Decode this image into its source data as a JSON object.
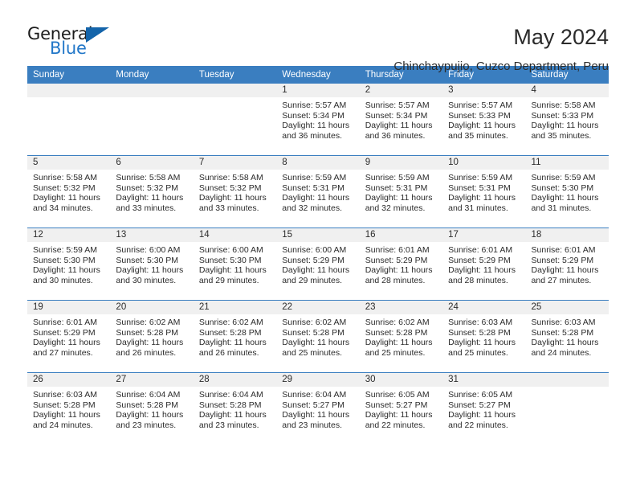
{
  "brand": {
    "name_top": "General",
    "name_bottom": "Blue",
    "accent_color": "#1464aa",
    "blue_text_color": "#2277c8"
  },
  "header": {
    "title": "May 2024",
    "location": "Chinchaypujio, Cuzco Department, Peru"
  },
  "calendar": {
    "header_color": "#3a7ec0",
    "daynum_band_color": "#f0f0f0",
    "weekdays": [
      "Sunday",
      "Monday",
      "Tuesday",
      "Wednesday",
      "Thursday",
      "Friday",
      "Saturday"
    ],
    "weeks": [
      [
        {
          "day": "",
          "sunrise": "",
          "sunset": "",
          "daylight": "",
          "empty": true
        },
        {
          "day": "",
          "sunrise": "",
          "sunset": "",
          "daylight": "",
          "empty": true
        },
        {
          "day": "",
          "sunrise": "",
          "sunset": "",
          "daylight": "",
          "empty": true
        },
        {
          "day": "1",
          "sunrise": "Sunrise: 5:57 AM",
          "sunset": "Sunset: 5:34 PM",
          "daylight": "Daylight: 11 hours and 36 minutes.",
          "empty": false
        },
        {
          "day": "2",
          "sunrise": "Sunrise: 5:57 AM",
          "sunset": "Sunset: 5:34 PM",
          "daylight": "Daylight: 11 hours and 36 minutes.",
          "empty": false
        },
        {
          "day": "3",
          "sunrise": "Sunrise: 5:57 AM",
          "sunset": "Sunset: 5:33 PM",
          "daylight": "Daylight: 11 hours and 35 minutes.",
          "empty": false
        },
        {
          "day": "4",
          "sunrise": "Sunrise: 5:58 AM",
          "sunset": "Sunset: 5:33 PM",
          "daylight": "Daylight: 11 hours and 35 minutes.",
          "empty": false
        }
      ],
      [
        {
          "day": "5",
          "sunrise": "Sunrise: 5:58 AM",
          "sunset": "Sunset: 5:32 PM",
          "daylight": "Daylight: 11 hours and 34 minutes.",
          "empty": false
        },
        {
          "day": "6",
          "sunrise": "Sunrise: 5:58 AM",
          "sunset": "Sunset: 5:32 PM",
          "daylight": "Daylight: 11 hours and 33 minutes.",
          "empty": false
        },
        {
          "day": "7",
          "sunrise": "Sunrise: 5:58 AM",
          "sunset": "Sunset: 5:32 PM",
          "daylight": "Daylight: 11 hours and 33 minutes.",
          "empty": false
        },
        {
          "day": "8",
          "sunrise": "Sunrise: 5:59 AM",
          "sunset": "Sunset: 5:31 PM",
          "daylight": "Daylight: 11 hours and 32 minutes.",
          "empty": false
        },
        {
          "day": "9",
          "sunrise": "Sunrise: 5:59 AM",
          "sunset": "Sunset: 5:31 PM",
          "daylight": "Daylight: 11 hours and 32 minutes.",
          "empty": false
        },
        {
          "day": "10",
          "sunrise": "Sunrise: 5:59 AM",
          "sunset": "Sunset: 5:31 PM",
          "daylight": "Daylight: 11 hours and 31 minutes.",
          "empty": false
        },
        {
          "day": "11",
          "sunrise": "Sunrise: 5:59 AM",
          "sunset": "Sunset: 5:30 PM",
          "daylight": "Daylight: 11 hours and 31 minutes.",
          "empty": false
        }
      ],
      [
        {
          "day": "12",
          "sunrise": "Sunrise: 5:59 AM",
          "sunset": "Sunset: 5:30 PM",
          "daylight": "Daylight: 11 hours and 30 minutes.",
          "empty": false
        },
        {
          "day": "13",
          "sunrise": "Sunrise: 6:00 AM",
          "sunset": "Sunset: 5:30 PM",
          "daylight": "Daylight: 11 hours and 30 minutes.",
          "empty": false
        },
        {
          "day": "14",
          "sunrise": "Sunrise: 6:00 AM",
          "sunset": "Sunset: 5:30 PM",
          "daylight": "Daylight: 11 hours and 29 minutes.",
          "empty": false
        },
        {
          "day": "15",
          "sunrise": "Sunrise: 6:00 AM",
          "sunset": "Sunset: 5:29 PM",
          "daylight": "Daylight: 11 hours and 29 minutes.",
          "empty": false
        },
        {
          "day": "16",
          "sunrise": "Sunrise: 6:01 AM",
          "sunset": "Sunset: 5:29 PM",
          "daylight": "Daylight: 11 hours and 28 minutes.",
          "empty": false
        },
        {
          "day": "17",
          "sunrise": "Sunrise: 6:01 AM",
          "sunset": "Sunset: 5:29 PM",
          "daylight": "Daylight: 11 hours and 28 minutes.",
          "empty": false
        },
        {
          "day": "18",
          "sunrise": "Sunrise: 6:01 AM",
          "sunset": "Sunset: 5:29 PM",
          "daylight": "Daylight: 11 hours and 27 minutes.",
          "empty": false
        }
      ],
      [
        {
          "day": "19",
          "sunrise": "Sunrise: 6:01 AM",
          "sunset": "Sunset: 5:29 PM",
          "daylight": "Daylight: 11 hours and 27 minutes.",
          "empty": false
        },
        {
          "day": "20",
          "sunrise": "Sunrise: 6:02 AM",
          "sunset": "Sunset: 5:28 PM",
          "daylight": "Daylight: 11 hours and 26 minutes.",
          "empty": false
        },
        {
          "day": "21",
          "sunrise": "Sunrise: 6:02 AM",
          "sunset": "Sunset: 5:28 PM",
          "daylight": "Daylight: 11 hours and 26 minutes.",
          "empty": false
        },
        {
          "day": "22",
          "sunrise": "Sunrise: 6:02 AM",
          "sunset": "Sunset: 5:28 PM",
          "daylight": "Daylight: 11 hours and 25 minutes.",
          "empty": false
        },
        {
          "day": "23",
          "sunrise": "Sunrise: 6:02 AM",
          "sunset": "Sunset: 5:28 PM",
          "daylight": "Daylight: 11 hours and 25 minutes.",
          "empty": false
        },
        {
          "day": "24",
          "sunrise": "Sunrise: 6:03 AM",
          "sunset": "Sunset: 5:28 PM",
          "daylight": "Daylight: 11 hours and 25 minutes.",
          "empty": false
        },
        {
          "day": "25",
          "sunrise": "Sunrise: 6:03 AM",
          "sunset": "Sunset: 5:28 PM",
          "daylight": "Daylight: 11 hours and 24 minutes.",
          "empty": false
        }
      ],
      [
        {
          "day": "26",
          "sunrise": "Sunrise: 6:03 AM",
          "sunset": "Sunset: 5:28 PM",
          "daylight": "Daylight: 11 hours and 24 minutes.",
          "empty": false
        },
        {
          "day": "27",
          "sunrise": "Sunrise: 6:04 AM",
          "sunset": "Sunset: 5:28 PM",
          "daylight": "Daylight: 11 hours and 23 minutes.",
          "empty": false
        },
        {
          "day": "28",
          "sunrise": "Sunrise: 6:04 AM",
          "sunset": "Sunset: 5:28 PM",
          "daylight": "Daylight: 11 hours and 23 minutes.",
          "empty": false
        },
        {
          "day": "29",
          "sunrise": "Sunrise: 6:04 AM",
          "sunset": "Sunset: 5:27 PM",
          "daylight": "Daylight: 11 hours and 23 minutes.",
          "empty": false
        },
        {
          "day": "30",
          "sunrise": "Sunrise: 6:05 AM",
          "sunset": "Sunset: 5:27 PM",
          "daylight": "Daylight: 11 hours and 22 minutes.",
          "empty": false
        },
        {
          "day": "31",
          "sunrise": "Sunrise: 6:05 AM",
          "sunset": "Sunset: 5:27 PM",
          "daylight": "Daylight: 11 hours and 22 minutes.",
          "empty": false
        },
        {
          "day": "",
          "sunrise": "",
          "sunset": "",
          "daylight": "",
          "empty": true
        }
      ]
    ]
  }
}
